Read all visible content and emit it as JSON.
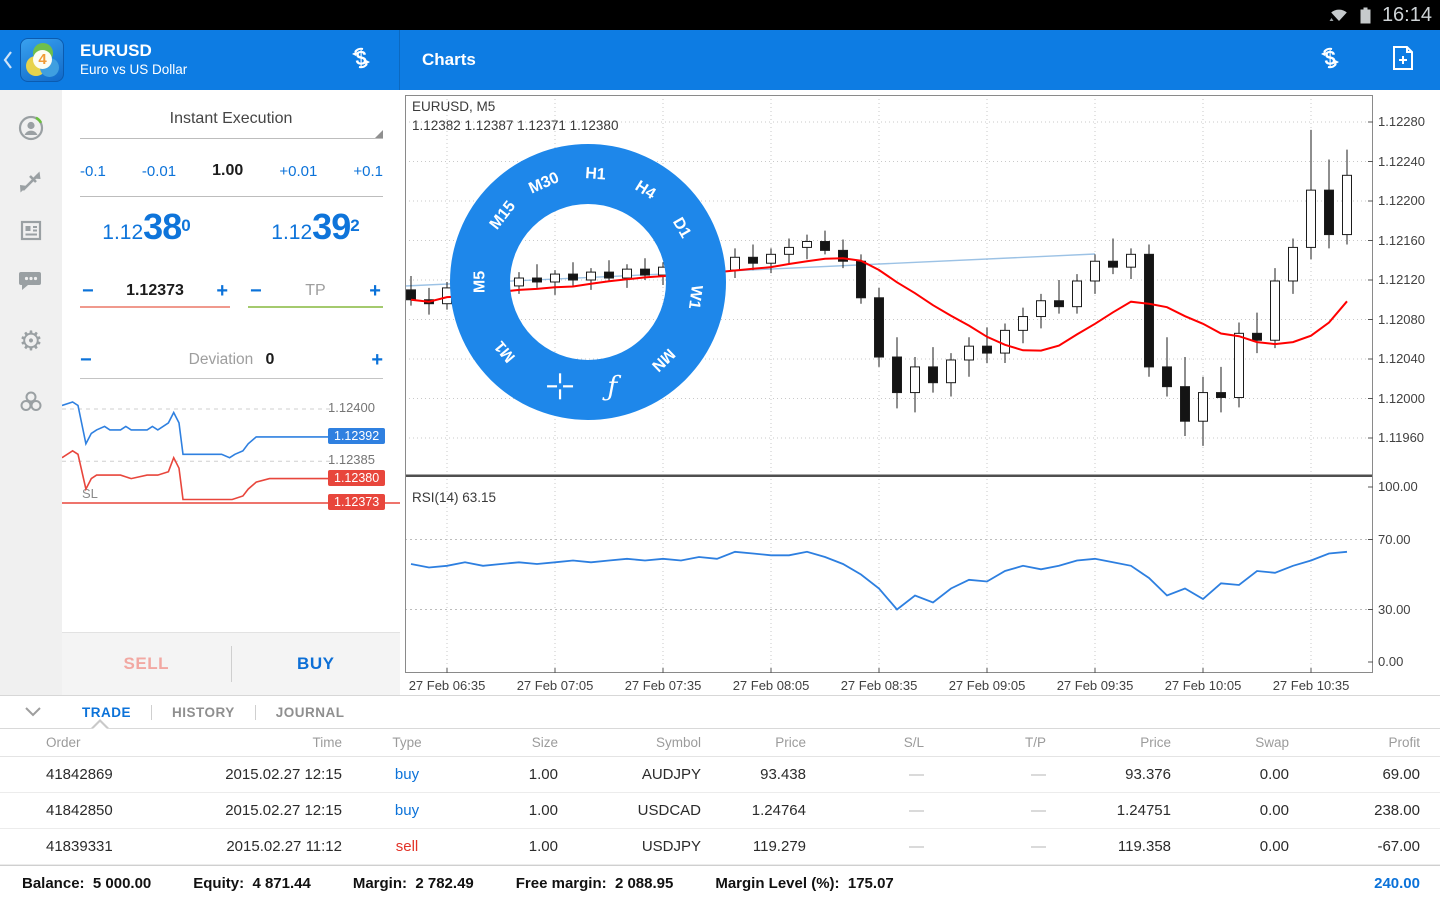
{
  "status_bar": {
    "time": "16:14"
  },
  "header": {
    "symbol": "EURUSD",
    "symbol_description": "Euro vs US Dollar",
    "section_title": "Charts"
  },
  "sidebar_icons": [
    "account-icon",
    "trade-arrows-icon",
    "news-icon",
    "chat-icon",
    "settings-gear-icon",
    "community-icon"
  ],
  "order_panel": {
    "execution_mode": "Instant Execution",
    "volume_steps": {
      "minus_large": "-0.1",
      "minus_small": "-0.01",
      "value": "1.00",
      "plus_small": "+0.01",
      "plus_large": "+0.1"
    },
    "sell_price": {
      "prefix": "1.12",
      "big": "38",
      "sup": "0"
    },
    "buy_price": {
      "prefix": "1.12",
      "big": "39",
      "sup": "2"
    },
    "sl": {
      "minus": "−",
      "value": "1.12373",
      "plus": "+"
    },
    "tp": {
      "minus": "−",
      "placeholder": "TP",
      "plus": "+"
    },
    "deviation": {
      "minus": "−",
      "label": "Deviation",
      "value": "0",
      "plus": "+"
    },
    "sell_label": "SELL",
    "buy_label": "BUY",
    "mini_chart": {
      "sl_text": "SL",
      "labels": [
        {
          "text": "1.12400",
          "type": "text",
          "price": 1.124
        },
        {
          "text": "1.12392",
          "type": "blue",
          "price": 1.12392
        },
        {
          "text": "1.12385",
          "type": "text",
          "price": 1.12385
        },
        {
          "text": "1.12380",
          "type": "red",
          "price": 1.1238
        },
        {
          "text": "1.12373",
          "type": "red",
          "price": 1.12373
        }
      ],
      "grid_prices": [
        1.124,
        1.12385
      ],
      "sl_price": 1.12373,
      "ask_color": "#2f80e0",
      "bid_color": "#e8463c",
      "ask_points": [
        [
          0,
          1.12401
        ],
        [
          0.04,
          1.12402
        ],
        [
          0.06,
          1.12401
        ],
        [
          0.09,
          1.1239
        ],
        [
          0.11,
          1.12393
        ],
        [
          0.13,
          1.12394
        ],
        [
          0.16,
          1.12395
        ],
        [
          0.18,
          1.12394
        ],
        [
          0.22,
          1.12394
        ],
        [
          0.24,
          1.12395
        ],
        [
          0.26,
          1.12394
        ],
        [
          0.32,
          1.12394
        ],
        [
          0.34,
          1.12395
        ],
        [
          0.36,
          1.12394
        ],
        [
          0.4,
          1.12396
        ],
        [
          0.42,
          1.12399
        ],
        [
          0.44,
          1.12396
        ],
        [
          0.455,
          1.12387
        ],
        [
          0.5,
          1.12387
        ],
        [
          0.56,
          1.12387
        ],
        [
          0.6,
          1.12387
        ],
        [
          0.63,
          1.12386
        ],
        [
          0.65,
          1.12387
        ],
        [
          0.68,
          1.12388
        ],
        [
          0.7,
          1.1239
        ],
        [
          0.73,
          1.12392
        ],
        [
          0.8,
          1.12392
        ],
        [
          1,
          1.12392
        ]
      ],
      "bid_points": [
        [
          0,
          1.12386
        ],
        [
          0.04,
          1.12388
        ],
        [
          0.06,
          1.12387
        ],
        [
          0.09,
          1.12377
        ],
        [
          0.11,
          1.1238
        ],
        [
          0.13,
          1.12381
        ],
        [
          0.18,
          1.12381
        ],
        [
          0.22,
          1.12381
        ],
        [
          0.26,
          1.1238
        ],
        [
          0.32,
          1.12381
        ],
        [
          0.36,
          1.12381
        ],
        [
          0.4,
          1.12382
        ],
        [
          0.42,
          1.12386
        ],
        [
          0.44,
          1.12383
        ],
        [
          0.455,
          1.12374
        ],
        [
          0.5,
          1.12374
        ],
        [
          0.56,
          1.12374
        ],
        [
          0.6,
          1.12374
        ],
        [
          0.64,
          1.12374
        ],
        [
          0.68,
          1.12375
        ],
        [
          0.7,
          1.12377
        ],
        [
          0.73,
          1.12379
        ],
        [
          0.78,
          1.1238
        ],
        [
          1,
          1.1238
        ]
      ]
    }
  },
  "chart": {
    "title": "EURUSD, M5",
    "ohlc_line": "1.12382 1.12387 1.12371 1.12380",
    "rsi_label": "RSI(14) 63.15",
    "price_ticks": [
      "1.12280",
      "1.12240",
      "1.12200",
      "1.12160",
      "1.12120",
      "1.12080",
      "1.12040",
      "1.12000",
      "1.11960"
    ],
    "rsi_ticks": [
      {
        "label": "100.00",
        "value": 100
      },
      {
        "label": "70.00",
        "value": 70
      },
      {
        "label": "30.00",
        "value": 30
      },
      {
        "label": "0.00",
        "value": 0
      }
    ],
    "time_labels": [
      "27 Feb 06:35",
      "27 Feb 07:05",
      "27 Feb 07:35",
      "27 Feb 08:05",
      "27 Feb 08:35",
      "27 Feb 09:05",
      "27 Feb 09:35",
      "27 Feb 10:05",
      "27 Feb 10:35"
    ],
    "chart_data": {
      "type": "candlestick+rsi",
      "symbol": "EURUSD",
      "timeframe": "M5",
      "ma_period": 10,
      "ma_color": "#ff0000",
      "rsi_period": 14,
      "rsi_last": 63.15,
      "candles": [
        [
          1.1211,
          1.12124,
          1.12094,
          1.121
        ],
        [
          1.121,
          1.12112,
          1.12085,
          1.12096
        ],
        [
          1.12096,
          1.12118,
          1.1209,
          1.12112
        ],
        [
          1.12112,
          1.1213,
          1.121,
          1.12106
        ],
        [
          1.12106,
          1.12125,
          1.12098,
          1.1212
        ],
        [
          1.1212,
          1.12132,
          1.12108,
          1.12114
        ],
        [
          1.12114,
          1.12128,
          1.12106,
          1.12122
        ],
        [
          1.12122,
          1.12136,
          1.12112,
          1.12118
        ],
        [
          1.12118,
          1.1213,
          1.12105,
          1.12126
        ],
        [
          1.12126,
          1.12138,
          1.12114,
          1.1212
        ],
        [
          1.1212,
          1.12132,
          1.1211,
          1.12128
        ],
        [
          1.12128,
          1.1214,
          1.12118,
          1.12122
        ],
        [
          1.12122,
          1.12136,
          1.12112,
          1.12131
        ],
        [
          1.12131,
          1.12142,
          1.1212,
          1.12125
        ],
        [
          1.12125,
          1.12138,
          1.12115,
          1.12133
        ],
        [
          1.12133,
          1.12146,
          1.12122,
          1.12128
        ],
        [
          1.12128,
          1.1214,
          1.12118,
          1.12136
        ],
        [
          1.12136,
          1.1215,
          1.12124,
          1.1213
        ],
        [
          1.1213,
          1.12152,
          1.12122,
          1.12143
        ],
        [
          1.12143,
          1.12156,
          1.1213,
          1.12137
        ],
        [
          1.12137,
          1.12152,
          1.12127,
          1.12146
        ],
        [
          1.12146,
          1.12162,
          1.12136,
          1.12153
        ],
        [
          1.12153,
          1.12166,
          1.12141,
          1.12159
        ],
        [
          1.12159,
          1.1217,
          1.12146,
          1.1215
        ],
        [
          1.1215,
          1.12161,
          1.12132,
          1.12139
        ],
        [
          1.12139,
          1.12146,
          1.12096,
          1.12102
        ],
        [
          1.12102,
          1.12112,
          1.12032,
          1.12042
        ],
        [
          1.12042,
          1.12062,
          1.1199,
          1.12006
        ],
        [
          1.12006,
          1.12042,
          1.11986,
          1.12032
        ],
        [
          1.12032,
          1.12052,
          1.12006,
          1.12016
        ],
        [
          1.12016,
          1.12046,
          1.12002,
          1.12039
        ],
        [
          1.12039,
          1.12062,
          1.12022,
          1.12053
        ],
        [
          1.12053,
          1.12072,
          1.12036,
          1.12046
        ],
        [
          1.12046,
          1.12076,
          1.12036,
          1.12069
        ],
        [
          1.12069,
          1.12092,
          1.12056,
          1.12083
        ],
        [
          1.12083,
          1.12106,
          1.12071,
          1.12099
        ],
        [
          1.12099,
          1.1212,
          1.12086,
          1.12093
        ],
        [
          1.12093,
          1.12126,
          1.12086,
          1.12119
        ],
        [
          1.12119,
          1.12146,
          1.12106,
          1.12139
        ],
        [
          1.12139,
          1.12162,
          1.12126,
          1.12133
        ],
        [
          1.12133,
          1.12152,
          1.12121,
          1.12146
        ],
        [
          1.12146,
          1.12156,
          1.12022,
          1.12032
        ],
        [
          1.12032,
          1.12062,
          1.12002,
          1.12012
        ],
        [
          1.12012,
          1.12042,
          1.11962,
          1.11977
        ],
        [
          1.11977,
          1.12022,
          1.11952,
          1.12006
        ],
        [
          1.12006,
          1.12032,
          1.11986,
          1.12001
        ],
        [
          1.12001,
          1.12077,
          1.11991,
          1.12066
        ],
        [
          1.12066,
          1.12087,
          1.12046,
          1.12059
        ],
        [
          1.12059,
          1.12132,
          1.12051,
          1.12119
        ],
        [
          1.12119,
          1.12162,
          1.12106,
          1.12153
        ],
        [
          1.12153,
          1.12272,
          1.12141,
          1.12211
        ],
        [
          1.12211,
          1.12242,
          1.12152,
          1.12166
        ],
        [
          1.12166,
          1.12252,
          1.12156,
          1.12226
        ]
      ],
      "rsi_values": [
        56,
        54,
        55,
        57,
        55,
        56,
        57,
        56,
        57,
        58,
        57,
        58,
        59,
        58,
        59,
        58,
        60,
        59,
        63,
        62,
        61,
        61,
        63,
        60,
        56,
        50,
        42,
        30,
        38,
        34,
        42,
        47,
        46,
        52,
        55,
        53,
        55,
        58,
        59,
        57,
        55,
        48,
        38,
        42,
        36,
        45,
        44,
        52,
        51,
        55,
        58,
        62,
        63
      ]
    }
  },
  "dial": {
    "color": "#1e87ea",
    "timeframes": [
      {
        "label": "M1",
        "angle": 140
      },
      {
        "label": "M5",
        "angle": -180
      },
      {
        "label": "M15",
        "angle": -142
      },
      {
        "label": "M30",
        "angle": -114
      },
      {
        "label": "H1",
        "angle": -86
      },
      {
        "label": "H4",
        "angle": -58
      },
      {
        "label": "D1",
        "angle": -30
      },
      {
        "label": "W1",
        "angle": 8
      },
      {
        "label": "MN",
        "angle": 46
      }
    ],
    "tools": [
      {
        "name": "crosshair-icon",
        "angle": 105
      },
      {
        "name": "indicator-f-icon",
        "angle": 77,
        "glyph": "ƒ"
      }
    ]
  },
  "bottom_panel": {
    "tabs": [
      {
        "label": "TRADE",
        "active": true
      },
      {
        "label": "HISTORY",
        "active": false
      },
      {
        "label": "JOURNAL",
        "active": false
      }
    ],
    "table": {
      "columns": [
        "Order",
        "Time",
        "Type",
        "Size",
        "Symbol",
        "Price",
        "S/L",
        "T/P",
        "Price",
        "Swap",
        "Profit"
      ],
      "aligns": [
        "l",
        "r",
        "c",
        "r",
        "r",
        "r",
        "r",
        "r",
        "r",
        "r",
        "r"
      ],
      "rows": [
        [
          "41842869",
          "2015.02.27 12:15",
          "buy",
          "1.00",
          "AUDJPY",
          "93.438",
          "—",
          "—",
          "93.376",
          "0.00",
          "69.00"
        ],
        [
          "41842850",
          "2015.02.27 12:15",
          "buy",
          "1.00",
          "USDCAD",
          "1.24764",
          "—",
          "—",
          "1.24751",
          "0.00",
          "238.00"
        ],
        [
          "41839331",
          "2015.02.27 11:12",
          "sell",
          "1.00",
          "USDJPY",
          "119.279",
          "—",
          "—",
          "119.358",
          "0.00",
          "-67.00"
        ]
      ]
    },
    "account": {
      "balance_label": "Balance:",
      "balance": "5 000.00",
      "equity_label": "Equity:",
      "equity": "4 871.44",
      "margin_label": "Margin:",
      "margin": "2 782.49",
      "free_margin_label": "Free margin:",
      "free_margin": "2 088.95",
      "margin_level_label": "Margin Level (%):",
      "margin_level": "175.07",
      "total": "240.00"
    }
  }
}
